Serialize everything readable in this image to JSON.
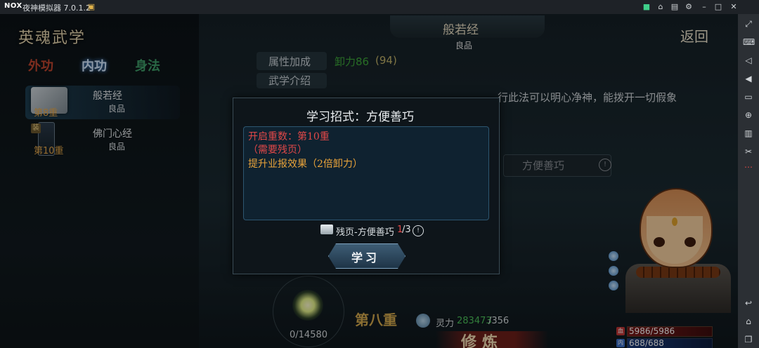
{
  "app": {
    "logo": "NOX",
    "title": "夜神模拟器 7.0.1.2"
  },
  "game": {
    "panel_title": "英魂武学",
    "tabs": [
      {
        "label": "外功"
      },
      {
        "label": "内功"
      },
      {
        "label": "身法"
      }
    ],
    "skills": [
      {
        "name": "般若经",
        "grade": "良品",
        "level": "第8重"
      },
      {
        "name": "佛门心经",
        "grade": "良品",
        "level": "第10重",
        "badge": "装"
      }
    ],
    "header": {
      "title": "般若经",
      "grade": "良品"
    },
    "return_label": "返回",
    "attr": {
      "label": "属性加成",
      "value": "卸力86",
      "extra": "(94)"
    },
    "intro_label": "武学介绍",
    "desc_text": "行此法可以明心净神，能拨开一切假象",
    "move_button": {
      "label": "方便善巧",
      "info": "!"
    },
    "meditation": {
      "count": "0/14580"
    },
    "stage": "第八重",
    "lingli": {
      "label": "灵力",
      "value": "283473",
      "max": "/356"
    },
    "xiulian_label": "修炼",
    "hp": {
      "icon": "血",
      "text": "5986/5986"
    },
    "mp": {
      "icon": "内",
      "text": "688/688"
    }
  },
  "modal": {
    "title": "学习招式：方便善巧",
    "line1": "开启重数：第10重",
    "line2": "（需要残页）",
    "line3": "提升业报效果（2倍卸力）",
    "req_label": "残页-方便善巧",
    "req_have": "1",
    "req_sep": "/3",
    "info": "!",
    "learn_label": "学习"
  },
  "titlebar_icons": [
    "android-icon",
    "pin-icon",
    "shirt-icon",
    "menu-icon",
    "settings-icon",
    "minimize-icon",
    "maximize-icon",
    "close-icon"
  ],
  "sidebar_icons": [
    "fullscreen-icon",
    "keyboard-icon",
    "volume-down-icon",
    "volume-up-icon",
    "screen-icon",
    "add-apk-icon",
    "print-icon",
    "cut-icon",
    "more-icon",
    "back-icon",
    "home-icon",
    "recent-icon"
  ]
}
